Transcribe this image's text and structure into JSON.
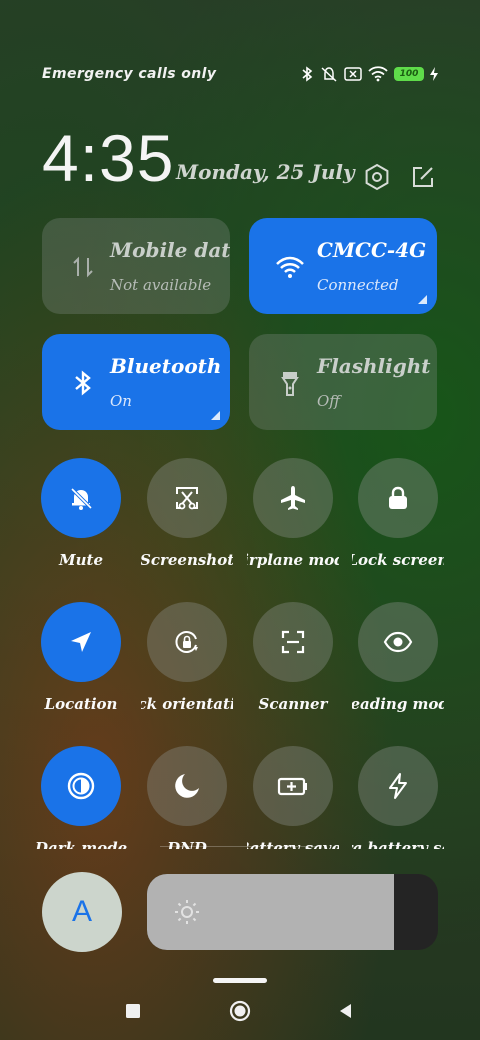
{
  "status": {
    "carrier": "Emergency calls only",
    "battery_level": "100",
    "icons": [
      "bluetooth-icon",
      "mute-vibrate-icon",
      "no-sim-icon",
      "wifi-icon",
      "battery-icon",
      "charging-icon"
    ]
  },
  "header": {
    "time": "4:35",
    "date": "Monday, 25 July",
    "settings_icon": "settings-hexagon-icon",
    "edit_icon": "edit-icon"
  },
  "tiles": [
    {
      "title": "Mobile data",
      "subtitle": "Not available",
      "icon": "mobile-data-icon",
      "active": false
    },
    {
      "title": "CMCC-4G",
      "subtitle": "Connected",
      "icon": "wifi-icon",
      "active": true
    },
    {
      "title": "Bluetooth",
      "subtitle": "On",
      "icon": "bluetooth-icon",
      "active": true
    },
    {
      "title": "Flashlight",
      "subtitle": "Off",
      "icon": "flashlight-icon",
      "active": false
    }
  ],
  "toggles": [
    {
      "label": "Mute",
      "icon": "mute-bell-icon",
      "active": true
    },
    {
      "label": "Screenshot",
      "icon": "screenshot-icon",
      "active": false
    },
    {
      "label": "Airplane mode",
      "icon": "airplane-icon",
      "active": false
    },
    {
      "label": "Lock screen",
      "icon": "lock-icon",
      "active": false
    },
    {
      "label": "Location",
      "icon": "location-icon",
      "active": true
    },
    {
      "label": "Lock orientation",
      "icon": "rotation-lock-icon",
      "active": false
    },
    {
      "label": "Scanner",
      "icon": "scanner-icon",
      "active": false
    },
    {
      "label": "Reading mode",
      "icon": "eye-icon",
      "active": false
    },
    {
      "label": "Dark mode",
      "icon": "dark-mode-icon",
      "active": true
    },
    {
      "label": "DND",
      "icon": "moon-icon",
      "active": false
    },
    {
      "label": "Battery saver",
      "icon": "battery-saver-icon",
      "active": false
    },
    {
      "label": "Ultra battery saver",
      "icon": "lightning-icon",
      "active": false
    }
  ],
  "bottom": {
    "font_button_label": "A",
    "brightness_level": 0.85,
    "brightness_icon": "sun-icon"
  },
  "nav": {
    "items": [
      "recents-square-icon",
      "home-circle-icon",
      "back-triangle-icon"
    ]
  },
  "colors": {
    "accent": "#1a73e8",
    "battery": "#5fdc4a"
  }
}
